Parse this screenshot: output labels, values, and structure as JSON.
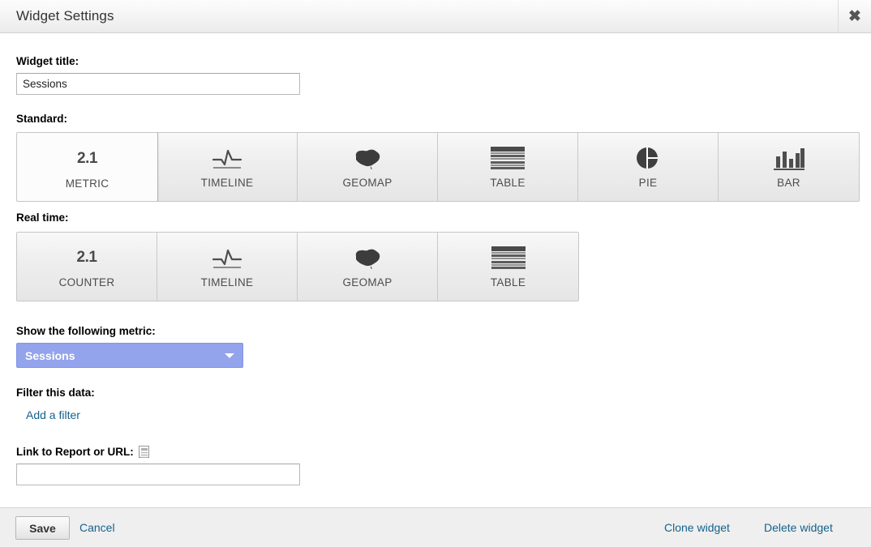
{
  "window": {
    "title": "Widget Settings",
    "close_icon": "close-icon"
  },
  "form": {
    "widget_title_label": "Widget title:",
    "widget_title_value": "Sessions",
    "widget_title_placeholder": "",
    "standard_label": "Standard:",
    "realtime_label": "Real time:",
    "metric_label": "Show the following metric:",
    "metric_value": "Sessions",
    "filter_label": "Filter this data:",
    "add_filter_link": "Add a filter",
    "link_label": "Link to Report or URL:",
    "link_value": "",
    "link_placeholder": "",
    "report_icon": "report-document-icon"
  },
  "standard_types": [
    {
      "label": "METRIC",
      "icon": "number-2-1-icon",
      "glyph": "2.1",
      "selected": true
    },
    {
      "label": "TIMELINE",
      "icon": "line-chart-icon",
      "glyph": "",
      "selected": false
    },
    {
      "label": "GEOMAP",
      "icon": "australia-map-icon",
      "glyph": "",
      "selected": false
    },
    {
      "label": "TABLE",
      "icon": "table-grid-icon",
      "glyph": "",
      "selected": false
    },
    {
      "label": "PIE",
      "icon": "pie-chart-icon",
      "glyph": "",
      "selected": false
    },
    {
      "label": "BAR",
      "icon": "bar-chart-icon",
      "glyph": "",
      "selected": false
    }
  ],
  "realtime_types": [
    {
      "label": "COUNTER",
      "icon": "number-2-1-icon",
      "glyph": "2.1",
      "selected": false
    },
    {
      "label": "TIMELINE",
      "icon": "line-chart-icon",
      "glyph": "",
      "selected": false
    },
    {
      "label": "GEOMAP",
      "icon": "australia-map-icon",
      "glyph": "",
      "selected": false
    },
    {
      "label": "TABLE",
      "icon": "table-grid-icon",
      "glyph": "",
      "selected": false
    }
  ],
  "footer": {
    "save_label": "Save",
    "cancel_label": "Cancel",
    "clone_label": "Clone widget",
    "delete_label": "Delete widget"
  },
  "colors": {
    "dropdown_bg": "#93a3ec",
    "link": "#15628c",
    "footer_bg": "#efefef"
  }
}
